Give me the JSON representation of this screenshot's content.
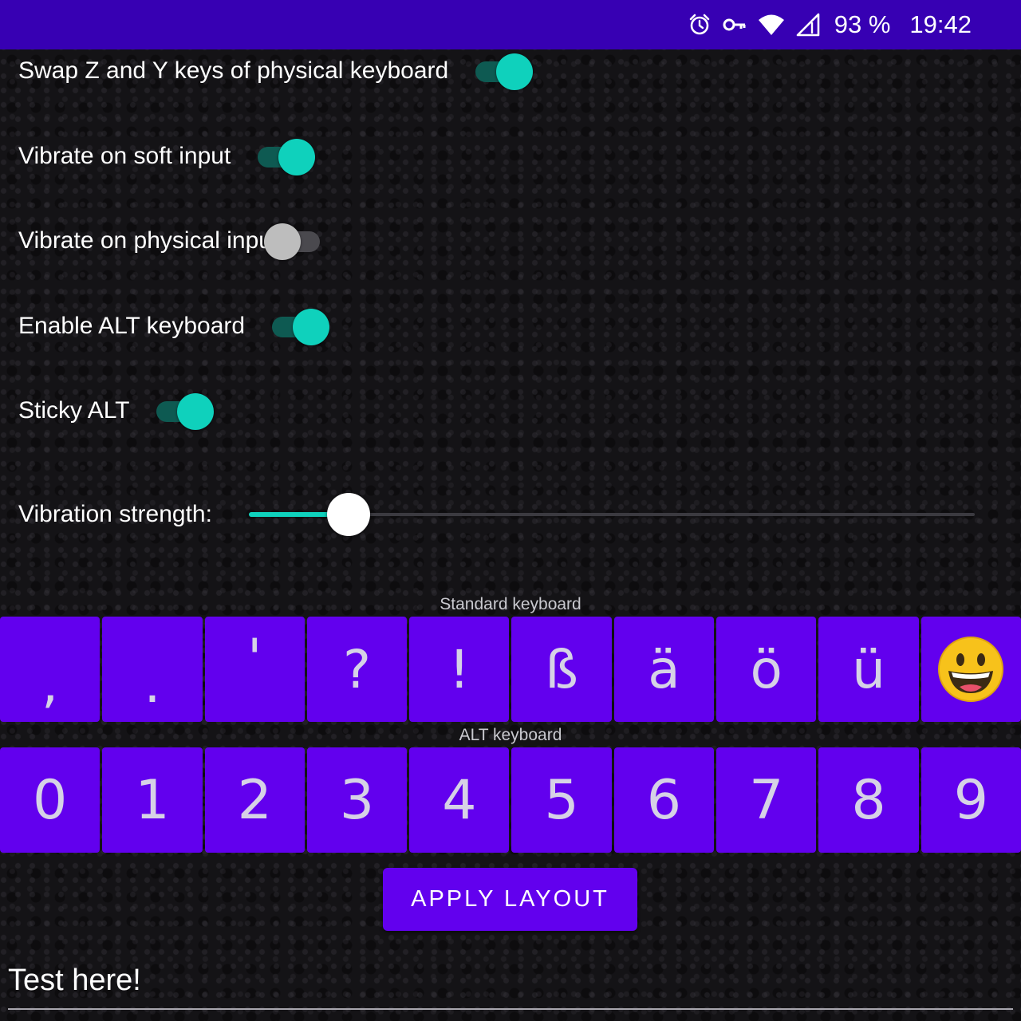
{
  "status_bar": {
    "battery": "93 %",
    "time": "19:42",
    "icons": [
      "alarm-icon",
      "vpn-key-icon",
      "wifi-icon",
      "cellular-signal-icon"
    ]
  },
  "settings": {
    "swap_zy": {
      "label": "Swap Z and Y keys of physical keyboard",
      "enabled": true
    },
    "vibrate_soft": {
      "label": "Vibrate on soft input",
      "enabled": true
    },
    "vibrate_physical": {
      "label": "Vibrate on physical input",
      "enabled": false
    },
    "enable_alt": {
      "label": "Enable ALT keyboard",
      "enabled": true
    },
    "sticky_alt": {
      "label": "Sticky ALT",
      "enabled": true
    }
  },
  "vibration": {
    "label": "Vibration strength:",
    "value_fraction": 0.137
  },
  "standard_keyboard": {
    "caption": "Standard keyboard",
    "keys": [
      ",",
      ".",
      "'",
      "?",
      "!",
      "ß",
      "ä",
      "ö",
      "ü",
      "grinning-face-emoji"
    ]
  },
  "alt_keyboard": {
    "caption": "ALT keyboard",
    "keys": [
      "0",
      "1",
      "2",
      "3",
      "4",
      "5",
      "6",
      "7",
      "8",
      "9"
    ]
  },
  "apply_button": {
    "label": "APPLY LAYOUT"
  },
  "test_input": {
    "value": "Test here!"
  },
  "colors": {
    "status_bar": "#3700b3",
    "accent": "#0fd1bc",
    "key_background": "#6200ee",
    "background": "#141316"
  }
}
